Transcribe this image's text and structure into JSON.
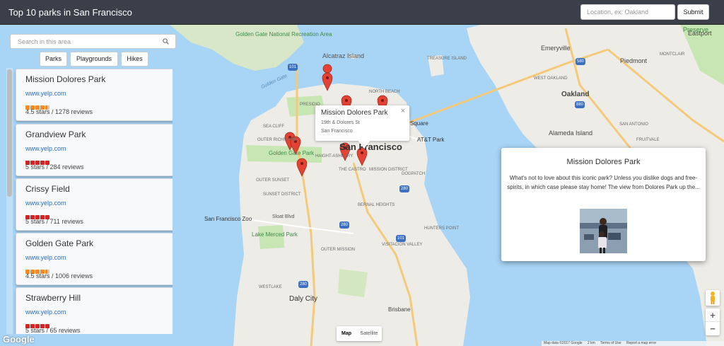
{
  "header": {
    "title": "Top 10 parks in San Francisco",
    "location_placeholder": "Location, ex: Oakland",
    "submit_label": "Submit"
  },
  "sidebar": {
    "search_placeholder": "Search in this area",
    "filters": [
      "Parks",
      "Playgrounds",
      "Hikes"
    ],
    "parks": [
      {
        "name": "Mission Dolores Park",
        "link": "www.yelp.com",
        "rating": 4.5,
        "rating_text": "4.5 stars / 1278 reviews",
        "star_color": "#f28c28"
      },
      {
        "name": "Grandview Park",
        "link": "www.yelp.com",
        "rating": 5,
        "rating_text": "5 stars / 284 reviews",
        "star_color": "#d32323"
      },
      {
        "name": "Crissy Field",
        "link": "www.yelp.com",
        "rating": 5,
        "rating_text": "5 stars / 711 reviews",
        "star_color": "#d32323"
      },
      {
        "name": "Golden Gate Park",
        "link": "www.yelp.com",
        "rating": 4.5,
        "rating_text": "4.5 stars / 1006 reviews",
        "star_color": "#f28c28"
      },
      {
        "name": "Strawberry Hill",
        "link": "www.yelp.com",
        "rating": 5,
        "rating_text": "5 stars / 65 reviews",
        "star_color": "#d32323"
      }
    ]
  },
  "info_window": {
    "name": "Mission Dolores Park",
    "address_line1": "19th & Dolores St",
    "address_line2": "San Francisco",
    "close": "×"
  },
  "detail": {
    "title": "Mission Dolores Park",
    "description": "What's not to love about this iconic park? Unless you dislike dogs and free-spirits, in which case please stay home! The view from Dolores Park up the..."
  },
  "map": {
    "type_map": "Map",
    "type_satellite": "Satellite",
    "zoom_in": "+",
    "zoom_out": "−",
    "logo": "Google",
    "attribution": [
      "Map data ©2017 Google",
      "2 km",
      "Terms of Use",
      "Report a map error"
    ],
    "labels": {
      "san_francisco": "San Francisco",
      "oakland": "Oakland",
      "alameda": "Alameda Island",
      "alcatraz": "Alcatraz Island",
      "treasure": "TREASURE ISLAND",
      "golden_gate_nra": "Golden Gate National Recreation Area",
      "golden_gate_park": "Golden Gate Park",
      "lake_merced": "Lake Merced Park",
      "sf_zoo": "San Francisco Zoo",
      "att_park": "AT&T Park",
      "daly_city": "Daly City",
      "brisbane": "Brisbane",
      "emeryville": "Emeryville",
      "piedmont": "Piedmont",
      "golden_gate": "Golden Gate",
      "outer_richmond": "OUTER RICHMOND",
      "outer_sunset": "OUTER SUNSET",
      "sunset_district": "SUNSET DISTRICT",
      "the_castro": "THE CASTRO",
      "mission_district": "MISSION DISTRICT",
      "dogpatch": "DOGPATCH",
      "bernal_heights": "BERNAL HEIGHTS",
      "hunters_point": "HUNTERS POINT",
      "outer_mission": "OUTER MISSION",
      "visitacion": "VISITACION VALLEY",
      "westlake": "WESTLAKE",
      "north_beach": "NORTH BEACH",
      "presidio": "PRESIDIO",
      "sea_cliff": "SEA CLIFF",
      "haight": "HAIGHT-ASHBURY",
      "west_oakland": "WEST OAKLAND",
      "san_antonio": "SAN ANTONIO",
      "fruitvale": "FRUITVALE",
      "montclair": "MONTCLAIR",
      "eastport": "Eastport",
      "preserve": "Preserve",
      "square": "Square",
      "sloat": "Sloat Blvd"
    }
  },
  "colors": {
    "header_bg": "#3a3f4a",
    "water": "#a8d4f5",
    "land": "#eeece6",
    "park": "#c8e5b4",
    "marker": "#e34234",
    "link": "#2a6ebb"
  }
}
